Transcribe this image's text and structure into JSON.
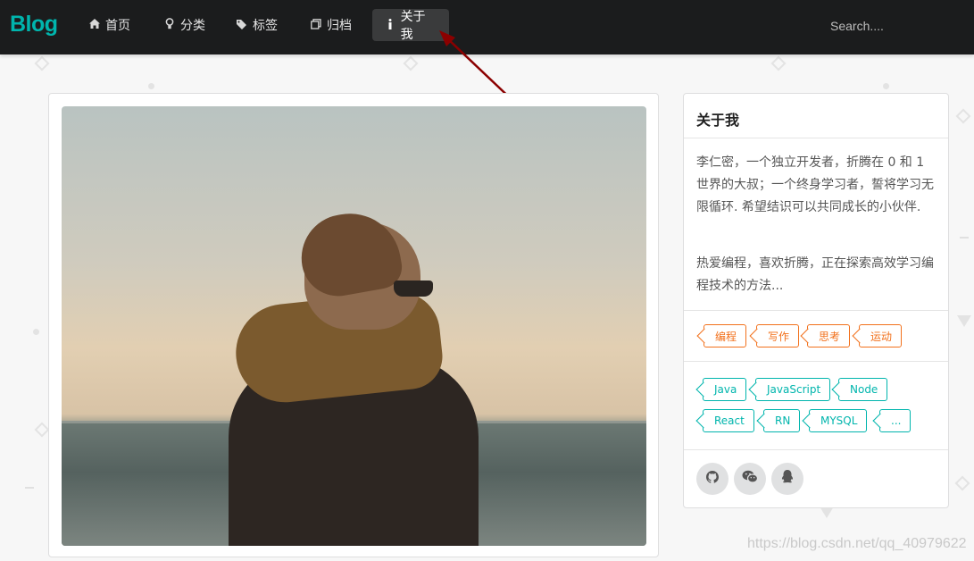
{
  "brand": "Blog",
  "nav": {
    "items": [
      {
        "label": "首页",
        "icon": "home-icon"
      },
      {
        "label": "分类",
        "icon": "idea-icon"
      },
      {
        "label": "标签",
        "icon": "tags-icon"
      },
      {
        "label": "归档",
        "icon": "clone-icon"
      },
      {
        "label": "关于我",
        "icon": "info-icon",
        "active": true
      }
    ],
    "search_placeholder": "Search...."
  },
  "about": {
    "title": "关于我",
    "paragraph1": "李仁密，一个独立开发者，折腾在 0 和 1 世界的大叔；一个终身学习者，誓将学习无限循环. 希望结识可以共同成长的小伙伴.",
    "paragraph2": "热爱编程，喜欢折腾，正在探索高效学习编程技术的方法..."
  },
  "interest_tags": [
    "编程",
    "写作",
    "思考",
    "运动"
  ],
  "tech_tags": [
    "Java",
    "JavaScript",
    "Node",
    "React",
    "RN",
    "MYSQL",
    "..."
  ],
  "social": [
    {
      "icon": "github-icon"
    },
    {
      "icon": "wechat-icon"
    },
    {
      "icon": "qq-icon"
    }
  ],
  "colors": {
    "brand": "#00b5ad",
    "navbar": "#1b1c1d",
    "tag_orange": "#f2711c",
    "tag_teal": "#00b5ad",
    "arrow": "#8b0000"
  },
  "watermark": "https://blog.csdn.net/qq_40979622"
}
